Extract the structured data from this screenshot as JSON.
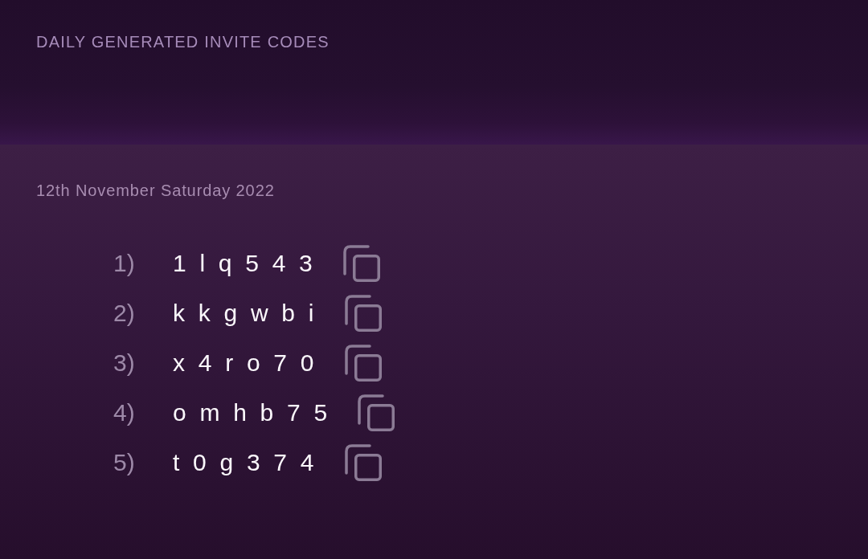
{
  "header": {
    "title": "DAILY GENERATED INVITE CODES"
  },
  "date": "12th November Saturday 2022",
  "codes": [
    {
      "number": "1)",
      "code": "1 l q 5 4 3"
    },
    {
      "number": "2)",
      "code": "k k g w b i"
    },
    {
      "number": "3)",
      "code": "x 4 r o 7 0"
    },
    {
      "number": "4)",
      "code": "o m h b 7 5"
    },
    {
      "number": "5)",
      "code": "t 0 g 3 7 4"
    }
  ]
}
